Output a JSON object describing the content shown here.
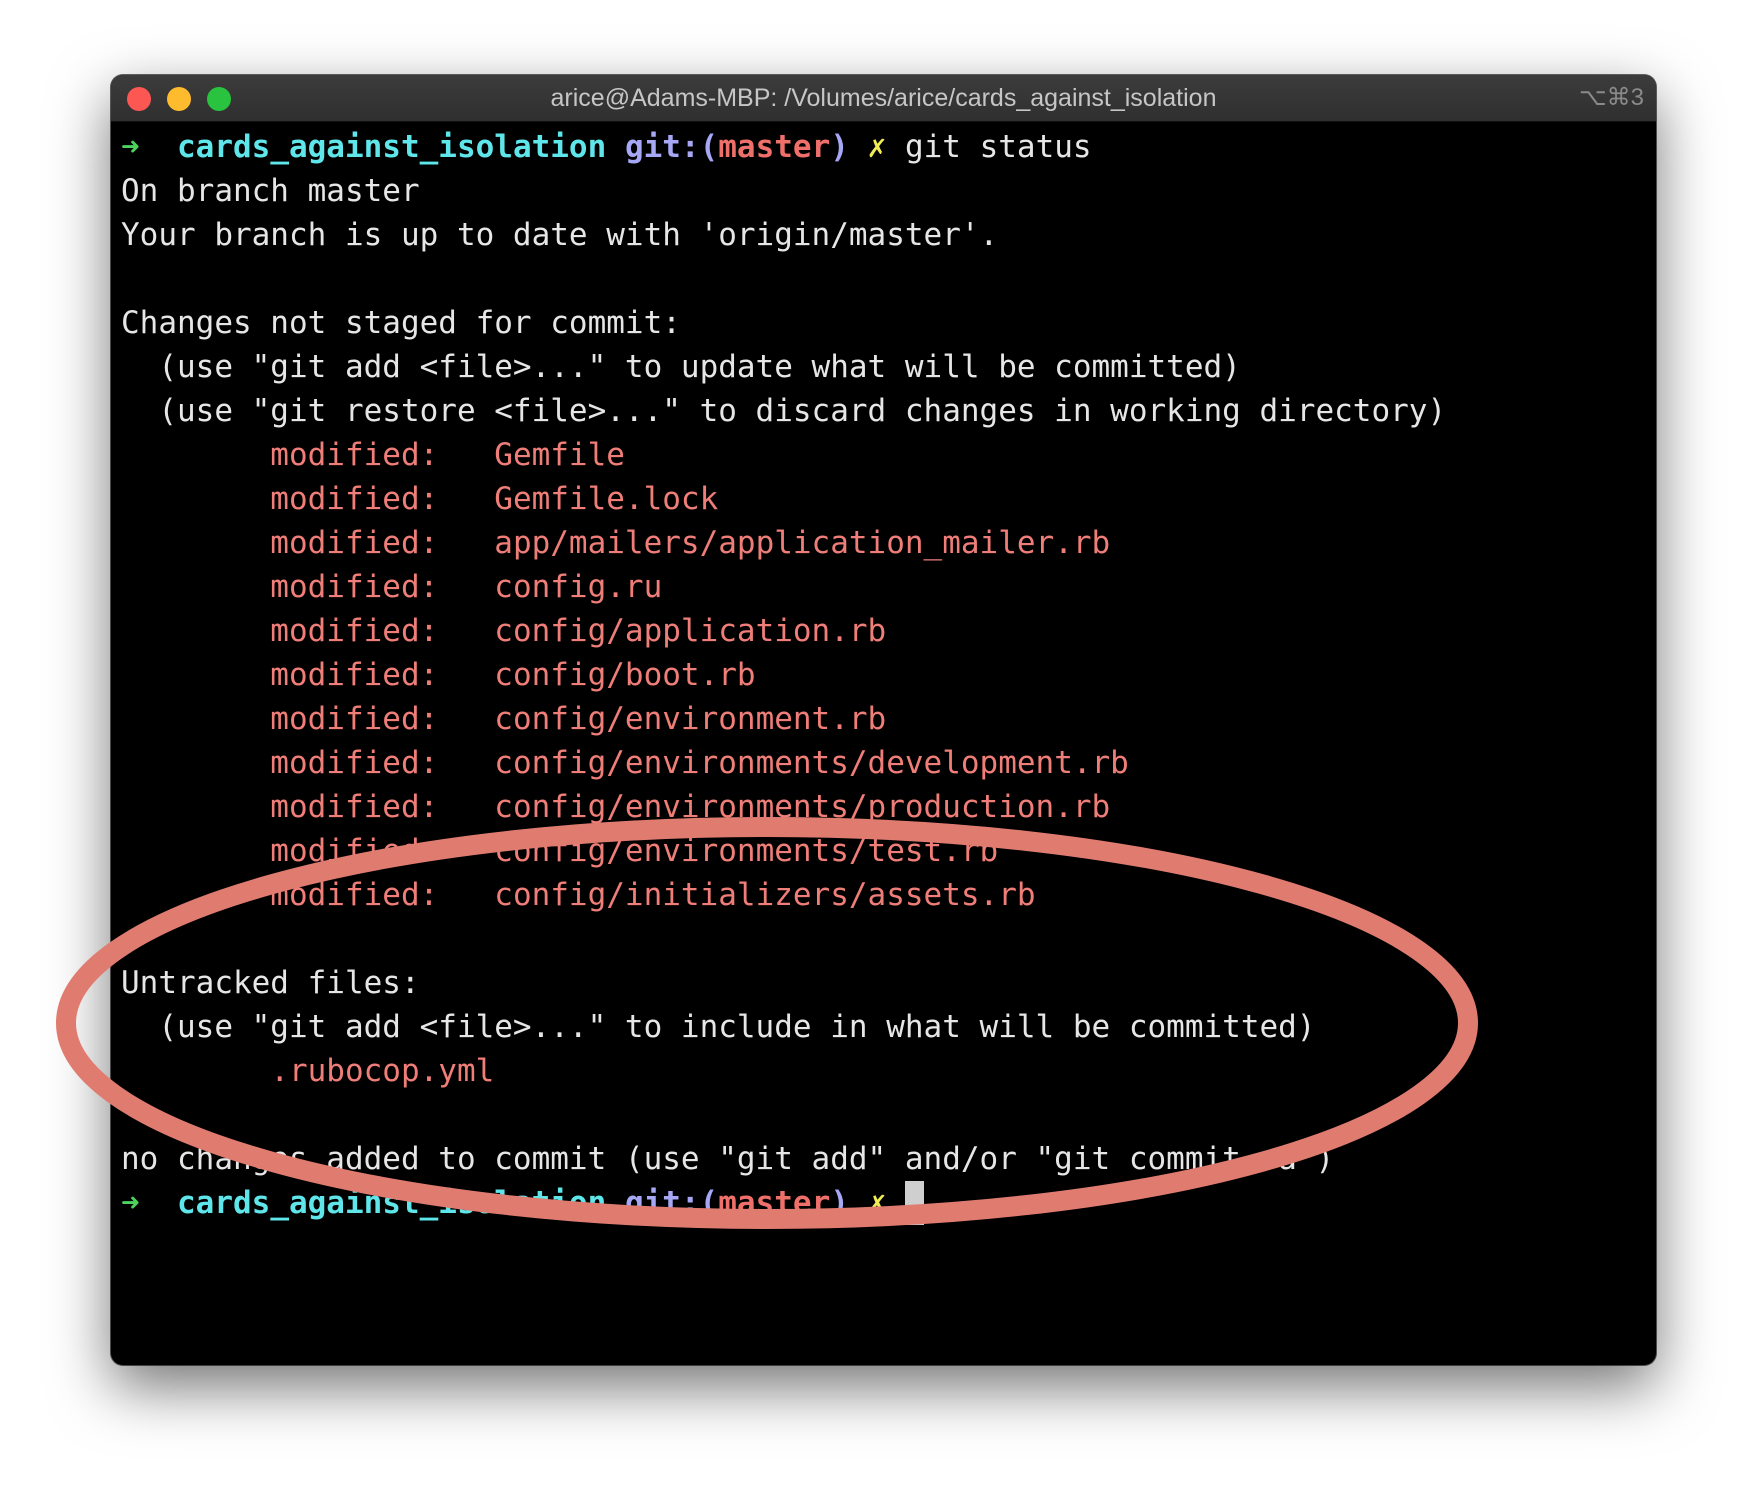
{
  "window": {
    "title": "arice@Adams-MBP: /Volumes/arice/cards_against_isolation",
    "shortcut": "⌥⌘3"
  },
  "colors": {
    "prompt_arrow": "#4bd35c",
    "directory": "#5ee6ea",
    "git_label": "#a6a7f5",
    "branch": "#ef6f6a",
    "dirty_marker": "#f1ec56",
    "modified": "#ef7d78",
    "annotation_ellipse": "#e07b70"
  },
  "prompt": {
    "arrow": "➜",
    "directory": "cards_against_isolation",
    "git_open": "git:(",
    "branch": "master",
    "git_close": ")",
    "dirty": "✗"
  },
  "command": "git status",
  "output": {
    "branch_line": "On branch master",
    "uptodate_line": "Your branch is up to date with 'origin/master'.",
    "not_staged_header": "Changes not staged for commit:",
    "not_staged_hint1": "  (use \"git add <file>...\" to update what will be committed)",
    "not_staged_hint2": "  (use \"git restore <file>...\" to discard changes in working directory)",
    "modified_label": "        modified:   ",
    "modified_files": [
      "Gemfile",
      "Gemfile.lock",
      "app/mailers/application_mailer.rb",
      "config.ru",
      "config/application.rb",
      "config/boot.rb",
      "config/environment.rb",
      "config/environments/development.rb",
      "config/environments/production.rb",
      "config/environments/test.rb",
      "config/initializers/assets.rb"
    ],
    "untracked_header": "Untracked files:",
    "untracked_hint": "  (use \"git add <file>...\" to include in what will be committed)",
    "untracked_indent": "        ",
    "untracked_files": [
      ".rubocop.yml"
    ],
    "summary_line": "no changes added to commit (use \"git add\" and/or \"git commit -a\")"
  }
}
